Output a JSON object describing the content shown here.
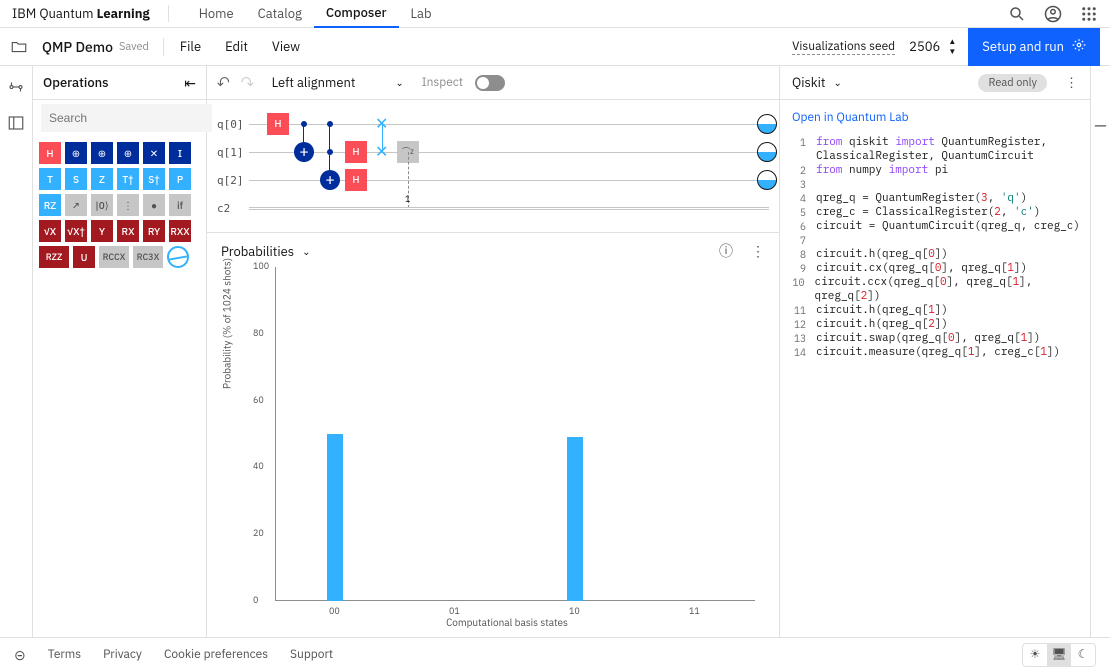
{
  "brand_prefix": "IBM Quantum ",
  "brand_bold": "Learning",
  "nav": [
    "Home",
    "Catalog",
    "Composer",
    "Lab"
  ],
  "nav_active": 2,
  "project_title": "QMP Demo",
  "saved_label": "Saved",
  "menu": [
    "File",
    "Edit",
    "View"
  ],
  "vis_seed_label": "Visualizations seed",
  "seed_value": "2506",
  "run_label": "Setup and run",
  "operations_label": "Operations",
  "search_placeholder": "Search",
  "gates": [
    {
      "l": "H",
      "c": "g-red"
    },
    {
      "l": "⊕",
      "c": "g-navy"
    },
    {
      "l": "⊕",
      "c": "g-navy",
      "sub": "c"
    },
    {
      "l": "⊕",
      "c": "g-navy",
      "sub": "cc"
    },
    {
      "l": "✕",
      "c": "g-navy"
    },
    {
      "l": "I",
      "c": "g-navy"
    },
    {
      "l": "T",
      "c": "g-blue"
    },
    {
      "l": "S",
      "c": "g-blue"
    },
    {
      "l": "Z",
      "c": "g-blue"
    },
    {
      "l": "T†",
      "c": "g-blue"
    },
    {
      "l": "S†",
      "c": "g-blue"
    },
    {
      "l": "P",
      "c": "g-blue"
    },
    {
      "l": "RZ",
      "c": "g-blue"
    },
    {
      "l": "↗",
      "c": "g-gray"
    },
    {
      "l": "|0⟩",
      "c": "g-gray"
    },
    {
      "l": "⋮",
      "c": "g-gray"
    },
    {
      "l": "●",
      "c": "g-gray"
    },
    {
      "l": "if",
      "c": "g-gray"
    },
    {
      "l": "√X",
      "c": "g-maroon"
    },
    {
      "l": "√X†",
      "c": "g-maroon"
    },
    {
      "l": "Y",
      "c": "g-maroon"
    },
    {
      "l": "RX",
      "c": "g-maroon"
    },
    {
      "l": "RY",
      "c": "g-maroon"
    },
    {
      "l": "RXX",
      "c": "g-maroon"
    },
    {
      "l": "RZZ",
      "c": "g-maroon",
      "w": 1
    },
    {
      "l": "U",
      "c": "g-maroon"
    },
    {
      "l": "RCCX",
      "c": "g-gray",
      "w": 1
    },
    {
      "l": "RC3X",
      "c": "g-gray",
      "w": 1
    },
    {
      "l": "",
      "c": "g-disk"
    }
  ],
  "alignment_label": "Left alignment",
  "inspect_label": "Inspect",
  "qubits": [
    "q[0]",
    "q[1]",
    "q[2]"
  ],
  "c_label": "c2",
  "meas_label": "1",
  "probs_label": "Probabilities",
  "qiskit_label": "Qiskit",
  "readonly_label": "Read only",
  "open_lab_label": "Open in Quantum Lab",
  "code": [
    [
      {
        "t": "from ",
        "c": "kw"
      },
      {
        "t": "qiskit "
      },
      {
        "t": "import ",
        "c": "kw"
      },
      {
        "t": "QuantumRegister,"
      }
    ],
    [
      {
        "t": "ClassicalRegister, QuantumCircuit"
      }
    ],
    [
      {
        "t": "from ",
        "c": "kw"
      },
      {
        "t": "numpy "
      },
      {
        "t": "import ",
        "c": "kw"
      },
      {
        "t": "pi"
      }
    ],
    [],
    [
      {
        "t": "qreg_q = QuantumRegister("
      },
      {
        "t": "3",
        "c": "num"
      },
      {
        "t": ", "
      },
      {
        "t": "'q'",
        "c": "str"
      },
      {
        "t": ")"
      }
    ],
    [
      {
        "t": "creg_c = ClassicalRegister("
      },
      {
        "t": "2",
        "c": "num"
      },
      {
        "t": ", "
      },
      {
        "t": "'c'",
        "c": "str"
      },
      {
        "t": ")"
      }
    ],
    [
      {
        "t": "circuit = QuantumCircuit(qreg_q, creg_c)"
      }
    ],
    [],
    [
      {
        "t": "circuit.h(qreg_q["
      },
      {
        "t": "0",
        "c": "num"
      },
      {
        "t": "])"
      }
    ],
    [
      {
        "t": "circuit.cx(qreg_q["
      },
      {
        "t": "0",
        "c": "num"
      },
      {
        "t": "], qreg_q["
      },
      {
        "t": "1",
        "c": "num"
      },
      {
        "t": "])"
      }
    ],
    [
      {
        "t": "circuit.ccx(qreg_q["
      },
      {
        "t": "0",
        "c": "num"
      },
      {
        "t": "], qreg_q["
      },
      {
        "t": "1",
        "c": "num"
      },
      {
        "t": "], qreg_q["
      },
      {
        "t": "2",
        "c": "num"
      },
      {
        "t": "])"
      }
    ],
    [
      {
        "t": "circuit.h(qreg_q["
      },
      {
        "t": "1",
        "c": "num"
      },
      {
        "t": "])"
      }
    ],
    [
      {
        "t": "circuit.h(qreg_q["
      },
      {
        "t": "2",
        "c": "num"
      },
      {
        "t": "])"
      }
    ],
    [
      {
        "t": "circuit.swap(qreg_q["
      },
      {
        "t": "0",
        "c": "num"
      },
      {
        "t": "], qreg_q["
      },
      {
        "t": "1",
        "c": "num"
      },
      {
        "t": "])"
      }
    ],
    [
      {
        "t": "circuit.measure(qreg_q["
      },
      {
        "t": "1",
        "c": "num"
      },
      {
        "t": "], creg_c["
      },
      {
        "t": "1",
        "c": "num"
      },
      {
        "t": "])"
      }
    ]
  ],
  "code_line_offsets": [
    1,
    0,
    2,
    3,
    4,
    5,
    6,
    7,
    8,
    9,
    10,
    11,
    12,
    13,
    14
  ],
  "footer": [
    "Terms",
    "Privacy",
    "Cookie preferences",
    "Support"
  ],
  "chart_data": {
    "type": "bar",
    "title": "",
    "xlabel": "Computational basis states",
    "ylabel": "Probability (% of 1024 shots)",
    "categories": [
      "00",
      "01",
      "10",
      "11"
    ],
    "values": [
      50,
      0,
      49,
      0
    ],
    "ylim": [
      0,
      100
    ],
    "yticks": [
      0,
      20,
      40,
      60,
      80,
      100
    ]
  }
}
